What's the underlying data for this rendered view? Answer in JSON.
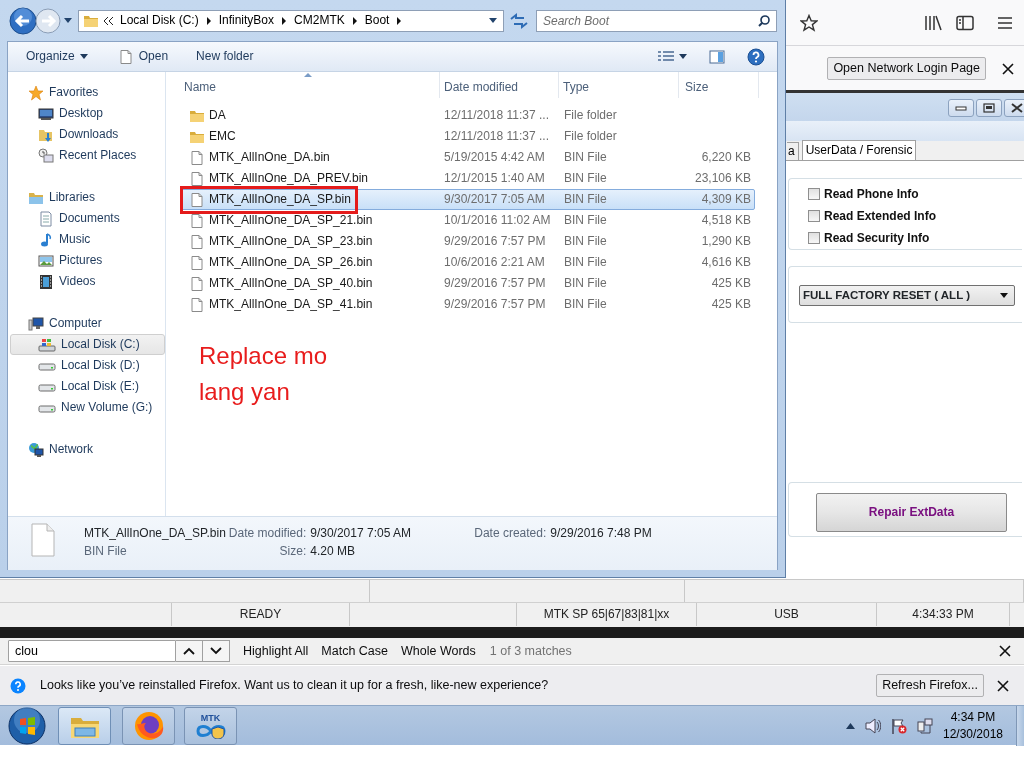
{
  "firefox": {
    "network_login_button": "Open Network Login Page"
  },
  "mtk_app": {
    "tabs": [
      {
        "label": "a",
        "selected": false
      },
      {
        "label": "UserData / Forensic",
        "selected": true
      }
    ],
    "checkboxes": [
      {
        "label": "Read Phone Info",
        "checked": false
      },
      {
        "label": "Read Extended Info",
        "checked": false
      },
      {
        "label": "Read Security Info",
        "checked": false
      }
    ],
    "dropdown": {
      "value": "FULL FACTORY RESET ( ALL )"
    },
    "action_button": "Repair ExtData",
    "status_bar": [
      "READY",
      "MTK SP 65|67|83|81|xx",
      "USB",
      "4:34:33 PM"
    ]
  },
  "explorer": {
    "breadcrumb": [
      "Local Disk (C:)",
      "InfinityBox",
      "CM2MTK",
      "Boot"
    ],
    "search": {
      "placeholder": "Search Boot"
    },
    "toolbar": {
      "organize": "Organize",
      "open": "Open",
      "new_folder": "New folder"
    },
    "nav": [
      {
        "label": "Favorites",
        "kind": "favorites",
        "selected": false,
        "children": [
          {
            "label": "Desktop",
            "kind": "desktop",
            "selected": false
          },
          {
            "label": "Downloads",
            "kind": "downloads",
            "selected": false
          },
          {
            "label": "Recent Places",
            "kind": "recent",
            "selected": false
          }
        ]
      },
      {
        "label": "Libraries",
        "kind": "libraries",
        "selected": false,
        "children": [
          {
            "label": "Documents",
            "kind": "documents",
            "selected": false
          },
          {
            "label": "Music",
            "kind": "music",
            "selected": false
          },
          {
            "label": "Pictures",
            "kind": "pictures",
            "selected": false
          },
          {
            "label": "Videos",
            "kind": "videos",
            "selected": false
          }
        ]
      },
      {
        "label": "Computer",
        "kind": "computer",
        "selected": false,
        "children": [
          {
            "label": "Local Disk (C:)",
            "kind": "system-drive",
            "selected": true
          },
          {
            "label": "Local Disk (D:)",
            "kind": "drive",
            "selected": false
          },
          {
            "label": "Local Disk (E:)",
            "kind": "drive",
            "selected": false
          },
          {
            "label": "New Volume (G:)",
            "kind": "drive",
            "selected": false
          }
        ]
      },
      {
        "label": "Network",
        "kind": "network",
        "selected": false
      }
    ],
    "columns": [
      "Name",
      "Date modified",
      "Type",
      "Size"
    ],
    "rows": [
      {
        "kind": "folder",
        "name": "DA",
        "date": "12/11/2018 11:37 ...",
        "type": "File folder",
        "selected": false
      },
      {
        "kind": "folder",
        "name": "EMC",
        "date": "12/11/2018 11:37 ...",
        "type": "File folder",
        "selected": false
      },
      {
        "kind": "file",
        "name": "MTK_AllInOne_DA.bin",
        "date": "5/19/2015 4:42 AM",
        "type": "BIN File",
        "size": "6,220 KB",
        "selected": false
      },
      {
        "kind": "file",
        "name": "MTK_AllInOne_DA_PREV.bin",
        "date": "12/1/2015 1:40 AM",
        "type": "BIN File",
        "size": "23,106 KB",
        "selected": false
      },
      {
        "kind": "file",
        "name": "MTK_AllInOne_DA_SP.bin",
        "date": "9/30/2017 7:05 AM",
        "type": "BIN File",
        "size": "4,309 KB",
        "selected": true
      },
      {
        "kind": "file",
        "name": "MTK_AllInOne_DA_SP_21.bin",
        "date": "10/1/2016 11:02 AM",
        "type": "BIN File",
        "size": "4,518 KB",
        "selected": false
      },
      {
        "kind": "file",
        "name": "MTK_AllInOne_DA_SP_23.bin",
        "date": "9/29/2016 7:57 PM",
        "type": "BIN File",
        "size": "1,290 KB",
        "selected": false
      },
      {
        "kind": "file",
        "name": "MTK_AllInOne_DA_SP_26.bin",
        "date": "10/6/2016 2:21 AM",
        "type": "BIN File",
        "size": "4,616 KB",
        "selected": false
      },
      {
        "kind": "file",
        "name": "MTK_AllInOne_DA_SP_40.bin",
        "date": "9/29/2016 7:57 PM",
        "type": "BIN File",
        "size": "425 KB",
        "selected": false
      },
      {
        "kind": "file",
        "name": "MTK_AllInOne_DA_SP_41.bin",
        "date": "9/29/2016 7:57 PM",
        "type": "BIN File",
        "size": "425 KB",
        "selected": false
      }
    ],
    "annotation": "Replace mo lang yan",
    "details": {
      "name": "MTK_AllInOne_DA_SP.bin",
      "type": "BIN File",
      "fields": [
        {
          "label": "Date modified:",
          "value": "9/30/2017 7:05 AM"
        },
        {
          "label": "Date created:",
          "value": "9/29/2016 7:48 PM"
        },
        {
          "label": "Size:",
          "value": "4.20 MB"
        }
      ]
    }
  },
  "find_bar": {
    "value": "clou",
    "options": [
      "Highlight All",
      "Match Case",
      "Whole Words"
    ],
    "result": "1 of 3 matches"
  },
  "notification": {
    "message": "Looks like you’ve reinstalled Firefox. Want us to clean it up for a fresh, like-new experience?",
    "button": "Refresh Firefox..."
  },
  "taskbar": {
    "apps": [
      {
        "kind": "explorer",
        "selected": true
      },
      {
        "kind": "firefox",
        "selected": false
      },
      {
        "kind": "mtk",
        "label": "MTK",
        "selected": false
      }
    ],
    "clock": {
      "time": "4:34 PM",
      "date": "12/30/2018"
    }
  }
}
